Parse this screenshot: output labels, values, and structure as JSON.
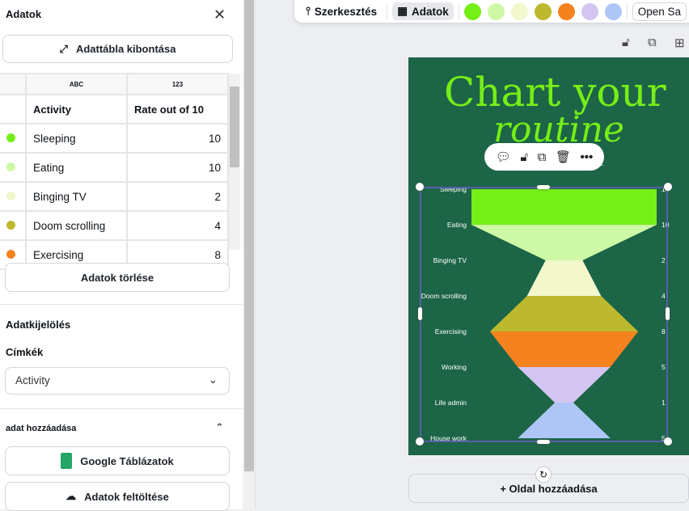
{
  "panel": {
    "title": "Adatok",
    "expand_label": "Adattábla kibontása",
    "clear_label": "Adatok törlése",
    "selection_heading": "Adatkijelölés",
    "labels_heading": "Címkék",
    "labels_value": "Activity",
    "add_data_heading": "adat hozzáadása",
    "google_label": "Google Táblázatok",
    "upload_label": "Adatok feltöltése"
  },
  "table": {
    "types": [
      "ABC",
      "123"
    ],
    "headers": [
      "Activity",
      "Rate out of 10"
    ],
    "rows": [
      {
        "label": "Sleeping",
        "value": "10",
        "color": "#76ee17"
      },
      {
        "label": "Eating",
        "value": "10",
        "color": "#cdf9a6"
      },
      {
        "label": "Binging TV",
        "value": "2",
        "color": "#f2f7cc"
      },
      {
        "label": "Doom scrolling",
        "value": "4",
        "color": "#bcb92e"
      },
      {
        "label": "Exercising",
        "value": "8",
        "color": "#f5821f"
      }
    ]
  },
  "toolbar": {
    "edit_label": "Szerkesztés",
    "data_label": "Adatok",
    "font": "Open Sa",
    "swatches": [
      "#76ee17",
      "#cdf9a6",
      "#f2f7cc",
      "#bcb92e",
      "#f5821f",
      "#d3c5f0",
      "#adc6f5"
    ]
  },
  "design": {
    "title_line1": "Chart your",
    "title_line2": "routine",
    "subtitle_fragment": "ta."
  },
  "add_page_label": "+ Oldal hozzáadása",
  "chart_data": {
    "type": "funnel",
    "categories": [
      "Sleeping",
      "Eating",
      "Binging TV",
      "Doom scrolling",
      "Exercising",
      "Working",
      "Life admin",
      "House work"
    ],
    "values": [
      10,
      10,
      2,
      4,
      8,
      5,
      1,
      5
    ],
    "colors": [
      "#76ee17",
      "#cdf9a6",
      "#f2f7cc",
      "#bcb92e",
      "#f5821f",
      "#d3c5f0",
      "#adc6f5"
    ],
    "ylabel": "",
    "xlabel": ""
  }
}
